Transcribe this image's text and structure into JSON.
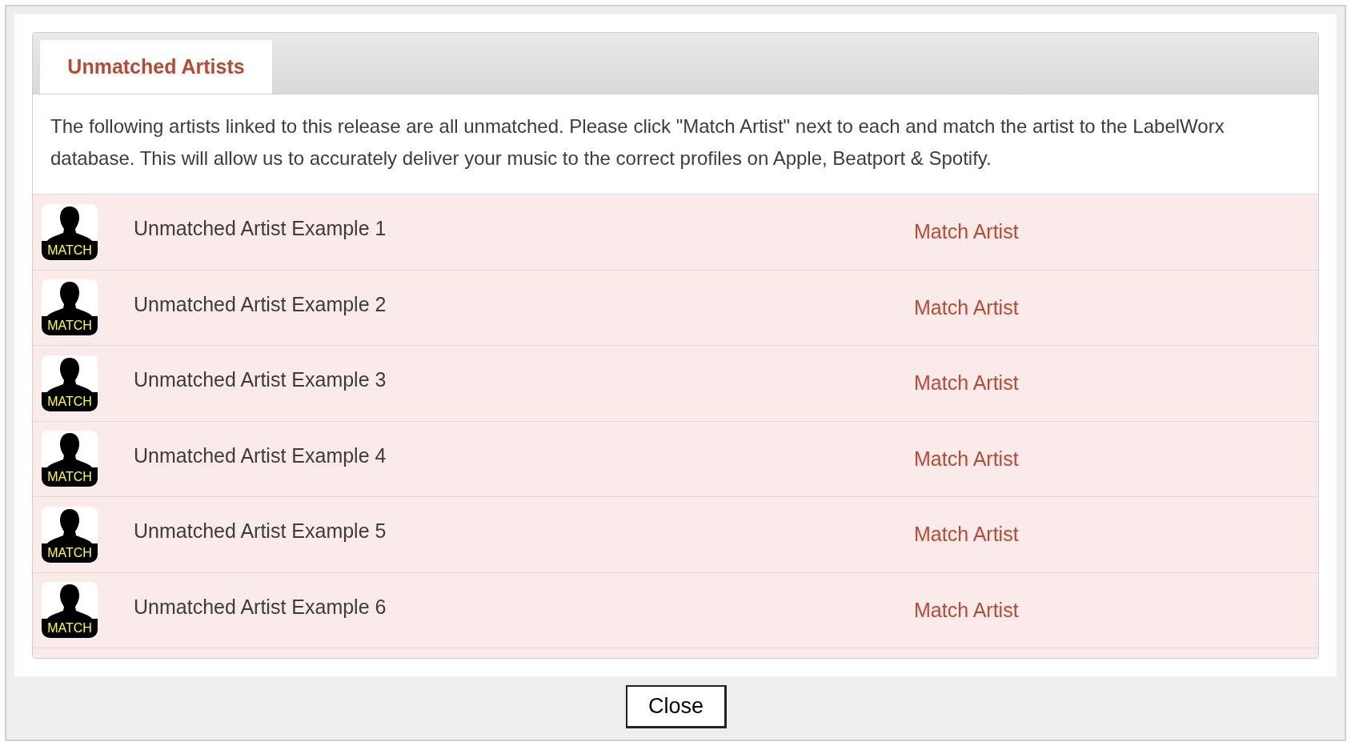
{
  "tabs": [
    {
      "label": "Unmatched Artists",
      "selected": true
    }
  ],
  "description": "The following artists linked to this release are all unmatched. Please click \"Match Artist\" next to each and match the artist to the LabelWorx database. This will allow us to accurately deliver your music to the correct profiles on Apple, Beatport & Spotify.",
  "artists": [
    {
      "badge": "MATCH",
      "name": "Unmatched Artist Example 1",
      "action": "Match Artist"
    },
    {
      "badge": "MATCH",
      "name": "Unmatched Artist Example 2",
      "action": "Match Artist"
    },
    {
      "badge": "MATCH",
      "name": "Unmatched Artist Example 3",
      "action": "Match Artist"
    },
    {
      "badge": "MATCH",
      "name": "Unmatched Artist Example 4",
      "action": "Match Artist"
    },
    {
      "badge": "MATCH",
      "name": "Unmatched Artist Example 5",
      "action": "Match Artist"
    },
    {
      "badge": "MATCH",
      "name": "Unmatched Artist Example 6",
      "action": "Match Artist"
    }
  ],
  "close_button": "Close"
}
